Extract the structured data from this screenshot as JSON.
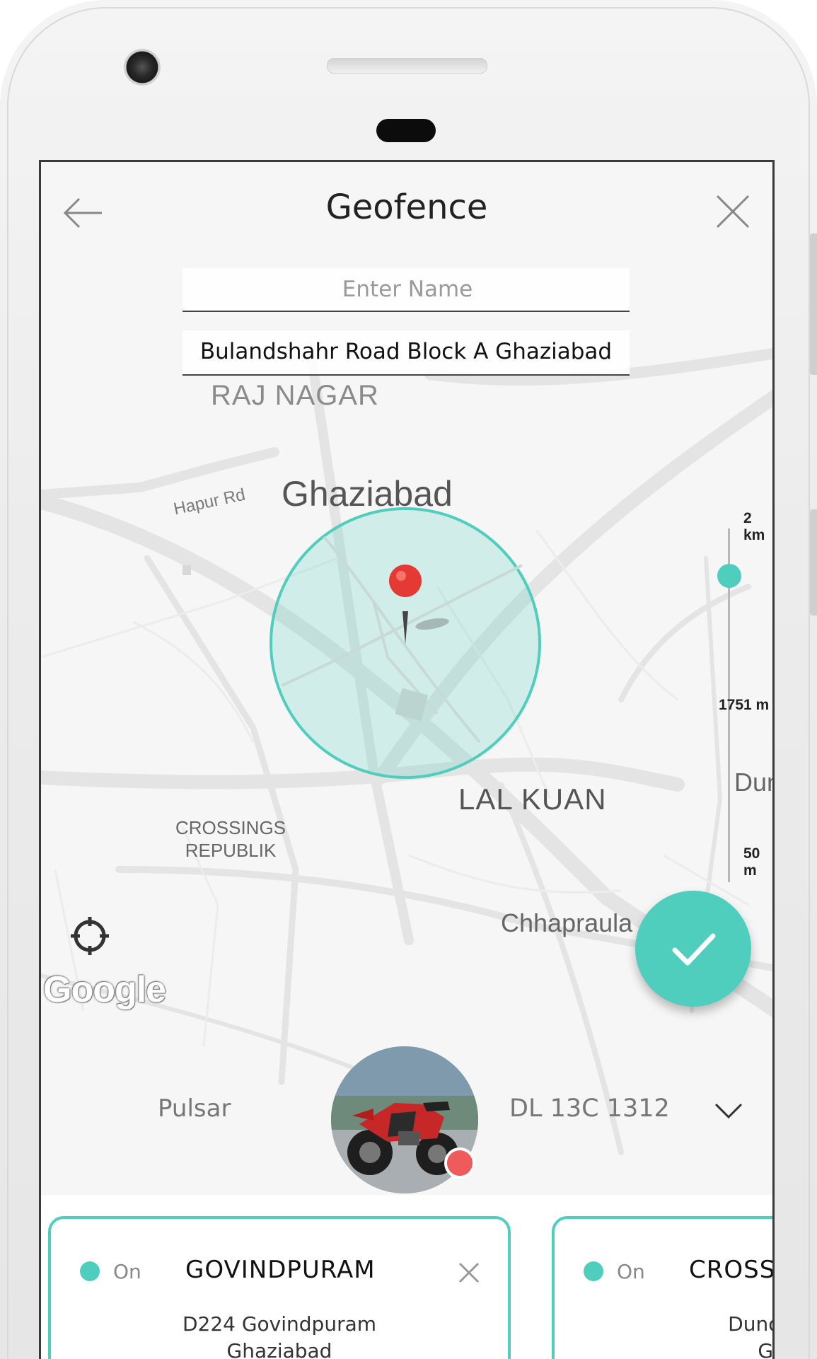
{
  "app": {
    "title": "Geofence"
  },
  "form": {
    "name_placeholder": "Enter Name",
    "name_value": "",
    "address": "Bulandshahr Road Block A Ghaziabad"
  },
  "map": {
    "labels": {
      "raj_nagar": "RAJ NAGAR",
      "ghaziabad": "Ghaziabad",
      "hapur_rd": "Hapur Rd",
      "lal_kuan": "LAL KUAN",
      "crossings_line1": "CROSSINGS",
      "crossings_line2": "REPUBLIK",
      "chhapraula": "Chhapraula",
      "dun": "Dun"
    },
    "attribution": "Google",
    "fence_color": "#4fcdbd",
    "pin_color": "#e53935"
  },
  "radius_slider": {
    "max_label": "2 km",
    "current_label": "1751 m",
    "min_label": "50 m",
    "value_m": 1751,
    "min_m": 50,
    "max_m": 2000
  },
  "vehicle": {
    "name": "Pulsar",
    "plate": "DL 13C 1312",
    "status_color": "#ef5a5a"
  },
  "geofences": [
    {
      "status": "On",
      "name": "GOVINDPURAM",
      "address_line1": "D224 Govindpuram",
      "address_line2": "Ghaziabad"
    },
    {
      "status": "On",
      "name": "CROSSHI",
      "address_line1": "Dundahera",
      "address_line2": "Ghaz"
    }
  ],
  "colors": {
    "accent": "#4fcdbd",
    "alert": "#ef5a5a"
  }
}
